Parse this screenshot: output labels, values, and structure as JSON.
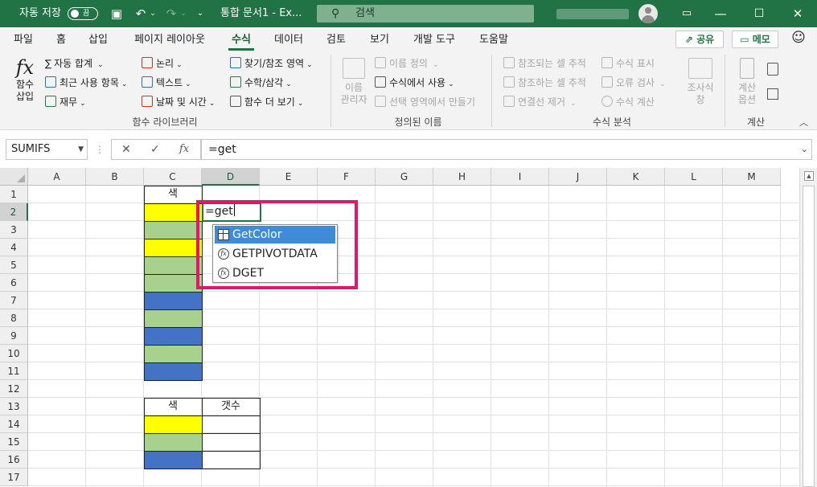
{
  "titlebar": {
    "autosave_label": "자동 저장",
    "autosave_state": "끔",
    "doc_title": "통합 문서1 - Ex...",
    "search_placeholder": "검색"
  },
  "tabs": [
    "파일",
    "홈",
    "삽입",
    "페이지 레이아웃",
    "수식",
    "데이터",
    "검토",
    "보기",
    "개발 도구",
    "도움말"
  ],
  "active_tab": "수식",
  "share_label": "공유",
  "memo_label": "메모",
  "ribbon": {
    "insert_function": [
      "함수",
      "삽입"
    ],
    "lib_col1": [
      "자동 합계",
      "최근 사용 항목",
      "재무"
    ],
    "lib_col2": [
      "논리",
      "텍스트",
      "날짜 및 시간"
    ],
    "lib_col3": [
      "찾기/참조 영역",
      "수학/삼각",
      "함수 더 보기"
    ],
    "lib_group": "함수 라이브러리",
    "name_manager": [
      "이름",
      "관리자"
    ],
    "defined": [
      "이름 정의",
      "수식에서 사용",
      "선택 영역에서 만들기"
    ],
    "defined_group": "정의된 이름",
    "audit_col1": [
      "참조되는 셀 추적",
      "참조하는 셀 추적",
      "연결선 제거"
    ],
    "audit_col2": [
      "수식 표시",
      "오류 검사",
      "수식 계산"
    ],
    "watch": [
      "조사식",
      "창"
    ],
    "audit_group": "수식 분석",
    "calc_options": [
      "계산",
      "옵션"
    ],
    "calc_group": "계산"
  },
  "formula_bar": {
    "name_box": "SUMIFS",
    "formula": "=get"
  },
  "columns": [
    "A",
    "B",
    "C",
    "D",
    "E",
    "F",
    "G",
    "H",
    "I",
    "J",
    "K",
    "L",
    "M"
  ],
  "rows": [
    "1",
    "2",
    "3",
    "4",
    "5",
    "6",
    "7",
    "8",
    "9",
    "10",
    "11",
    "12",
    "13",
    "14",
    "15",
    "16",
    "17"
  ],
  "cells": {
    "c1": "색",
    "c13": "색",
    "d13": "갯수",
    "d2": "=get"
  },
  "colors": {
    "yellow": "#ffff00",
    "green": "#a9d18e",
    "blue": "#4472c4",
    "excel_green": "#217346",
    "highlight": "#e0186c"
  },
  "color_column_c_rows_2_to_11": [
    "yellow",
    "green",
    "yellow",
    "green",
    "green",
    "blue",
    "green",
    "blue",
    "green",
    "blue"
  ],
  "color_column_c_rows_14_to_16": [
    "yellow",
    "green",
    "blue"
  ],
  "autocomplete": [
    {
      "label": "GetColor",
      "icon": "table-icon",
      "selected": true
    },
    {
      "label": "GETPIVOTDATA",
      "icon": "function-icon",
      "selected": false
    },
    {
      "label": "DGET",
      "icon": "function-icon",
      "selected": false
    }
  ]
}
